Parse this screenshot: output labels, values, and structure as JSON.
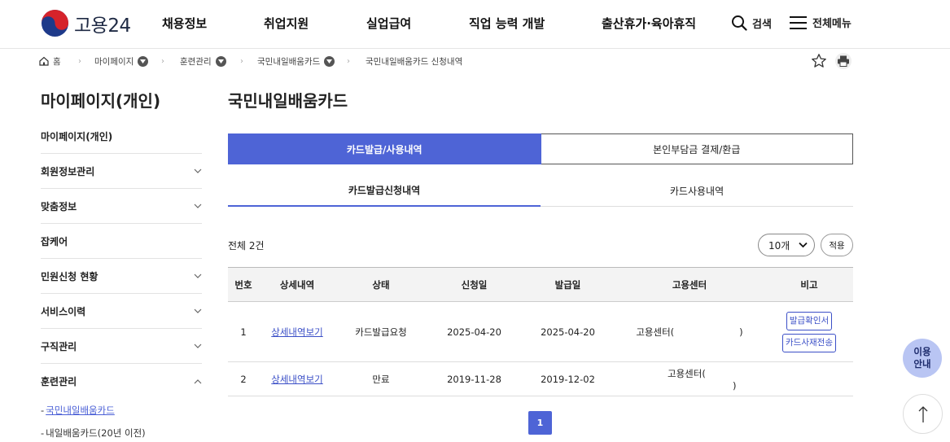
{
  "header": {
    "logo_text": "고용24",
    "nav": [
      "채용정보",
      "취업지원",
      "실업급여",
      "직업 능력 개발",
      "출산휴가·육아휴직"
    ],
    "search_label": "검색",
    "menu_label": "전체메뉴"
  },
  "breadcrumb": {
    "home": "홈",
    "items": [
      "마이페이지",
      "훈련관리",
      "국민내일배움카드",
      "국민내일배움카드 신청내역"
    ]
  },
  "sidebar": {
    "title": "마이페이지(개인)",
    "items": [
      "마이페이지(개인)",
      "회원정보관리",
      "맞춤정보",
      "잡케어",
      "민원신청 현황",
      "서비스이력",
      "구직관리",
      "훈련관리"
    ],
    "sub_items": [
      "국민내일배움카드",
      "내일배움카드(20년 이전)"
    ]
  },
  "main": {
    "title": "국민내일배움카드",
    "segment_tabs": [
      "카드발급/사용내역",
      "본인부담금 결제/환급"
    ],
    "sub_tabs": [
      "카드발급신청내역",
      "카드사용내역"
    ],
    "total_label": "전체 2건",
    "page_size": "10개",
    "apply_label": "적용",
    "table": {
      "headers": [
        "번호",
        "상세내역",
        "상태",
        "신청일",
        "발급일",
        "고용센터",
        "비고"
      ],
      "rows": [
        {
          "no": "1",
          "detail": "상세내역보기",
          "status": "카드발급요청",
          "apply_date": "2025-04-20",
          "issue_date": "2025-04-20",
          "center": "고용센터(",
          "center_close": ")",
          "buttons": [
            "발급확인서",
            "카드사재전송"
          ]
        },
        {
          "no": "2",
          "detail": "상세내역보기",
          "status": "만료",
          "apply_date": "2019-11-28",
          "issue_date": "2019-12-02",
          "center": "고용센터(",
          "center_close": ")",
          "buttons": []
        }
      ]
    },
    "pagination": {
      "current": "1"
    }
  },
  "floating": {
    "guide_line1": "이용",
    "guide_line2": "안내"
  },
  "colors": {
    "accent": "#4e64d6",
    "link": "#3b4fc7"
  }
}
